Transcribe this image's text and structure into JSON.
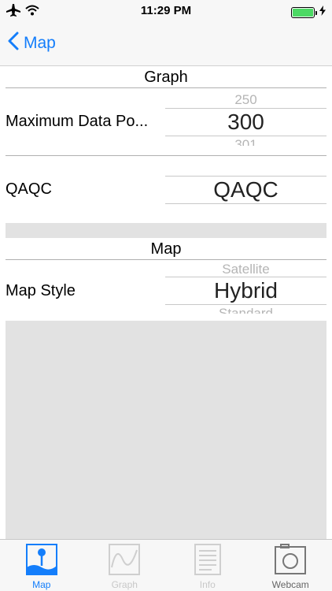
{
  "status_bar": {
    "time": "11:29 PM",
    "icons": [
      "airplane-icon",
      "wifi-icon",
      "battery-icon",
      "charging-bolt-icon"
    ],
    "battery_color": "#4cd964"
  },
  "nav": {
    "back_label": "Map",
    "accent_color": "#147efb"
  },
  "graph_section": {
    "header": "Graph",
    "rows": [
      {
        "label": "Maximum Data Po...",
        "picker_above": "250",
        "picker_value": "300",
        "picker_below": "301"
      },
      {
        "label": "QAQC",
        "picker_above": "",
        "picker_value": "QAQC",
        "picker_below": ""
      }
    ]
  },
  "map_section": {
    "header": "Map",
    "rows": [
      {
        "label": "Map Style",
        "picker_above": "Satellite",
        "picker_value": "Hybrid",
        "picker_below": "Standard"
      }
    ]
  },
  "tab_bar": {
    "tabs": [
      {
        "label": "Map",
        "icon": "map-pin-icon",
        "state": "active"
      },
      {
        "label": "Graph",
        "icon": "graph-wave-icon",
        "state": "dim"
      },
      {
        "label": "Info",
        "icon": "info-list-icon",
        "state": "dim"
      },
      {
        "label": "Webcam",
        "icon": "camera-icon",
        "state": "normal"
      }
    ]
  }
}
